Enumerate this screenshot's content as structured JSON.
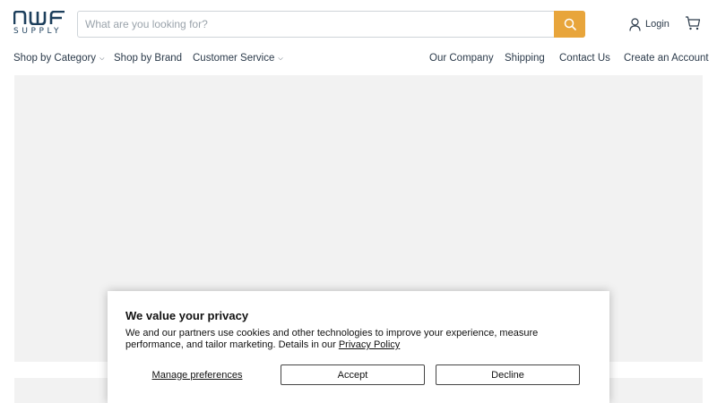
{
  "brand": {
    "logo_text": "NWF",
    "logo_subtext": "SUPPLY",
    "logo_color": "#1d3f5c"
  },
  "search": {
    "placeholder": "What are you looking for?",
    "value": "",
    "button_icon": "search-icon",
    "button_color": "#e8a53b"
  },
  "account": {
    "login_label": "Login",
    "login_icon": "user-icon",
    "cart_icon": "cart-icon"
  },
  "nav": {
    "left": [
      {
        "label": "Shop by Category",
        "has_dropdown": true
      },
      {
        "label": "Shop by Brand",
        "has_dropdown": false
      },
      {
        "label": "Customer Service",
        "has_dropdown": true
      }
    ],
    "right": [
      {
        "label": "Our Company"
      },
      {
        "label": "Shipping"
      },
      {
        "label": "Contact Us"
      },
      {
        "label": "Create an Account"
      }
    ]
  },
  "consent": {
    "title": "We value your privacy",
    "body": "We and our partners use cookies and other technologies to improve your experience, measure performance, and tailor marketing. Details in our ",
    "policy_link": "Privacy Policy",
    "manage_label": "Manage preferences",
    "accept_label": "Accept",
    "decline_label": "Decline"
  },
  "colors": {
    "text": "#2b3a4a",
    "placeholder_bg": "#f2f2f2",
    "accent": "#e8a53b"
  }
}
